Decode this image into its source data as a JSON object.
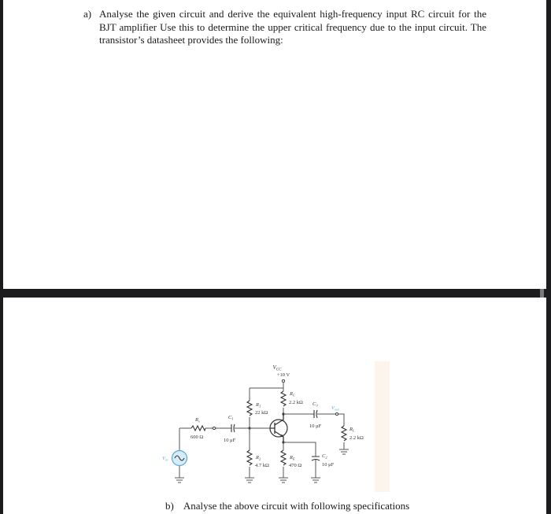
{
  "question_a": {
    "marker": "a)",
    "text": "Analyse the given circuit and derive the equivalent high-frequency input RC circuit for the BJT amplifier Use this to determine the upper critical frequency due to the input circuit. The transistor’s datasheet provides the following:"
  },
  "question_b": {
    "marker": "b)",
    "text": "Analyse the above circuit with following specifications"
  },
  "circuit": {
    "vcc": {
      "label": "V",
      "sub": "CC",
      "value": "+10 V"
    },
    "source": {
      "label": "V",
      "sub": "in"
    },
    "output": {
      "label": "V",
      "sub": "out"
    },
    "rs": {
      "label": "R",
      "sub": "s",
      "value": "600 Ω"
    },
    "c1": {
      "label": "C",
      "sub": "1",
      "value": "10 μF"
    },
    "r1": {
      "label": "R",
      "sub": "1",
      "value": "22 kΩ"
    },
    "r2": {
      "label": "R",
      "sub": "2",
      "value": "4.7 kΩ"
    },
    "rc": {
      "label": "R",
      "sub": "C",
      "value": "2.2 kΩ"
    },
    "re": {
      "label": "R",
      "sub": "E",
      "value": "470 Ω"
    },
    "c2": {
      "label": "C",
      "sub": "2",
      "value": "10 μF"
    },
    "c3": {
      "label": "C",
      "sub": "3",
      "value": "10 μF"
    },
    "rl": {
      "label": "R",
      "sub": "L",
      "value": "2.2 kΩ"
    },
    "accent_color": "#5aa9d6",
    "source_fill": "#d6ecf8"
  }
}
